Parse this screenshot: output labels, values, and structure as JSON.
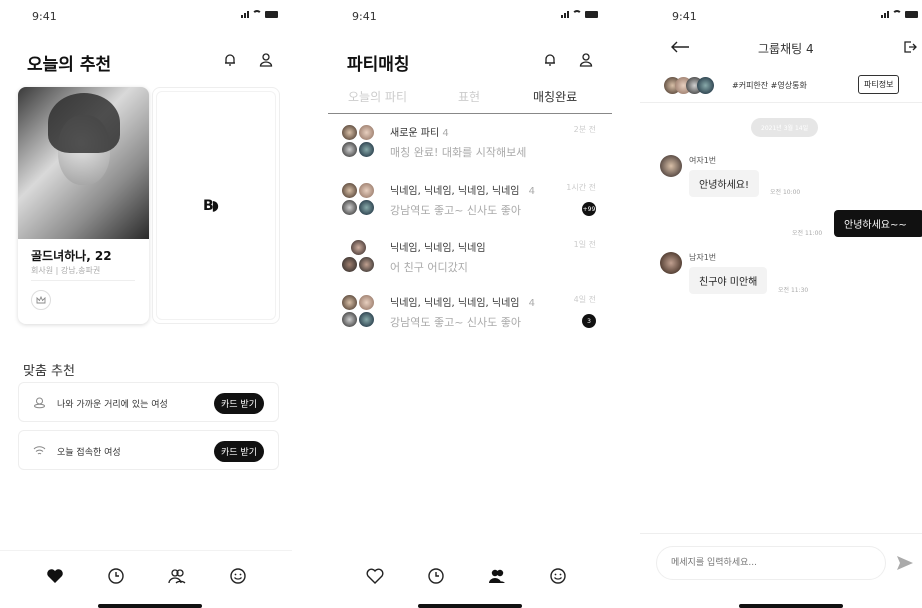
{
  "status": {
    "time": "9:41"
  },
  "screen1": {
    "title": "오늘의 추천",
    "profile": {
      "name": "골드녀하나, 22",
      "detail": "회사원 | 강남,송파권"
    },
    "custom_title": "맞춤 추천",
    "recs": [
      {
        "label": "나와 가까운 거리에 있는 여성",
        "button": "카드 받기"
      },
      {
        "label": "오늘 접속한 여성",
        "button": "카드 받기"
      }
    ],
    "logo_text": "B◗"
  },
  "screen2": {
    "title": "파티매칭",
    "tabs": [
      "오늘의 파티",
      "표현",
      "매칭완료"
    ],
    "chats": [
      {
        "name": "새로운 파티",
        "count": "4",
        "time": "2분 전",
        "msg": "매칭 완료! 대화를 시작해보세",
        "badge": ""
      },
      {
        "name": "닉네임, 닉네임, 닉네임, 닉네임",
        "count": "4",
        "time": "1시간 전",
        "msg": "강남역도 좋고~ 신사도 좋아",
        "badge": "+99"
      },
      {
        "name": "닉네임, 닉네임, 닉네임",
        "count": "",
        "time": "1일 전",
        "msg": "어 친구 어디갔지",
        "badge": ""
      },
      {
        "name": "닉네임, 닉네임, 닉네임, 닉네임",
        "count": "4",
        "time": "4일 전",
        "msg": "강남역도 좋고~ 신사도 좋아",
        "badge": "3"
      }
    ]
  },
  "screen3": {
    "title": "그룹채팅 4",
    "tags": "#커피한잔 #영상통화",
    "party_info": "파티정보",
    "date": "2021년 3월 14일",
    "messages": [
      {
        "sender": "여자1번",
        "text": "안녕하세요!",
        "time": "오전 10:00"
      },
      {
        "sender": "",
        "text": "안녕하세요~~",
        "time": "오전 11:00"
      },
      {
        "sender": "남자1번",
        "text": "친구야 미안해",
        "time": "오전 11:30"
      }
    ],
    "input_placeholder": "메세지를 입력하세요..."
  },
  "colors": {
    "accent": "#111111",
    "muted": "#aaaaaa"
  },
  "icons": [
    "bell-icon",
    "user-icon",
    "heart-icon",
    "clock-icon",
    "people-icon",
    "smile-icon",
    "back-arrow-icon",
    "exit-icon",
    "send-icon",
    "crown-icon",
    "location-icon",
    "wifi-icon"
  ]
}
